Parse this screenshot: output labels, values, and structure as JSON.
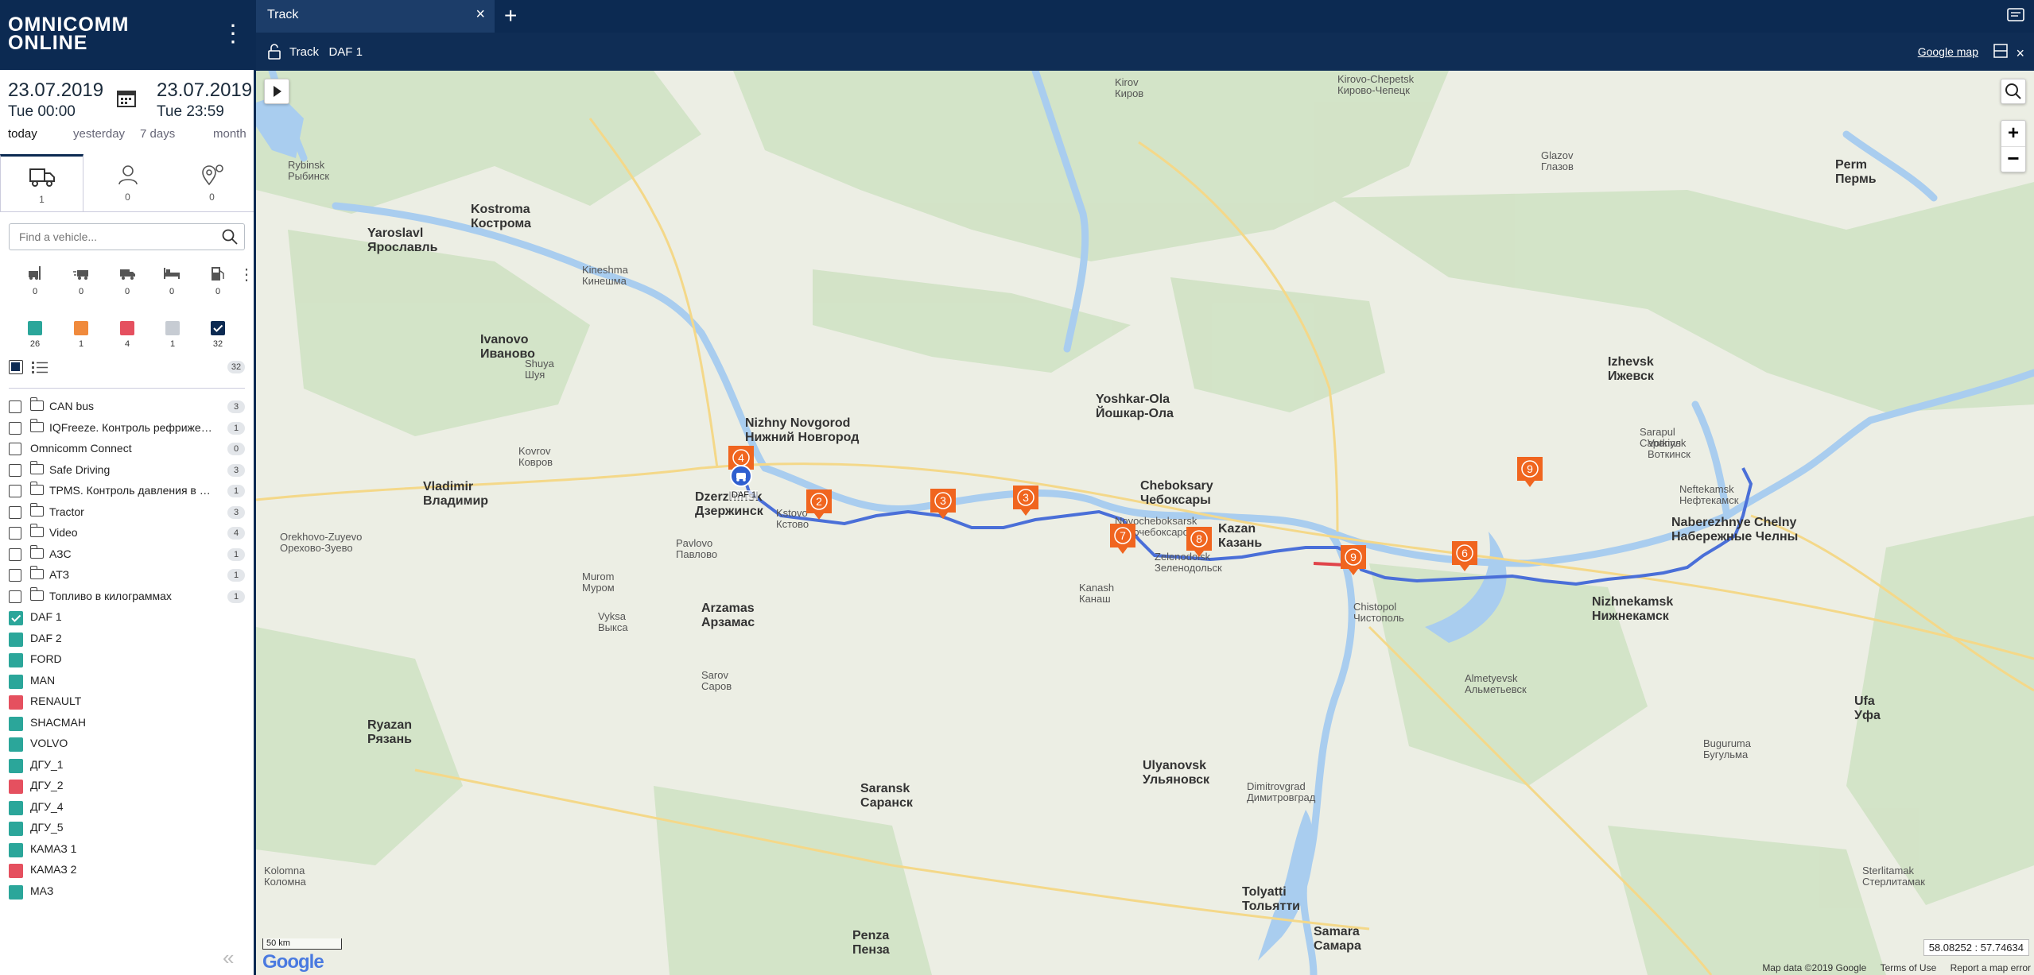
{
  "app": {
    "logo_line1": "OMNICOMM",
    "logo_line2": "ONLINE"
  },
  "dates": {
    "from_date": "23.07.2019",
    "from_time": "Tue 00:00",
    "to_date": "23.07.2019",
    "to_time": "Tue 23:59",
    "quick": [
      "today",
      "yesterday",
      "7 days",
      "month"
    ]
  },
  "tabs": [
    {
      "name": "vehicles",
      "count": "1"
    },
    {
      "name": "drivers",
      "count": "0"
    },
    {
      "name": "geozones",
      "count": "0"
    }
  ],
  "search": {
    "placeholder": "Find a vehicle..."
  },
  "status_counts": [
    "0",
    "0",
    "0",
    "0",
    "0"
  ],
  "color_filters": [
    {
      "color": "#2ba69a",
      "count": "26"
    },
    {
      "color": "#f08a3c",
      "count": "1"
    },
    {
      "color": "#e5505f",
      "count": "4"
    },
    {
      "color": "#c7ccd3",
      "count": "1"
    },
    {
      "color": "#0c2a52",
      "count": "32"
    }
  ],
  "total_count": "32",
  "groups": [
    {
      "label": "CAN bus",
      "count": "3"
    },
    {
      "label": "IQFreeze. Контроль рефрижератора",
      "count": "1"
    },
    {
      "label": "Omnicomm Connect",
      "count": "0"
    },
    {
      "label": "Safe Driving",
      "count": "3"
    },
    {
      "label": "TPMS. Контроль давления в шинах",
      "count": "1"
    },
    {
      "label": "Tractor",
      "count": "3"
    },
    {
      "label": "Video",
      "count": "4"
    },
    {
      "label": "АЗС",
      "count": "1"
    },
    {
      "label": "АТЗ",
      "count": "1"
    },
    {
      "label": "Топливо в килограммах",
      "count": "1"
    }
  ],
  "vehicles": [
    {
      "label": "DAF 1",
      "color": "#2ba69a",
      "checked": true
    },
    {
      "label": "DAF 2",
      "color": "#2ba69a"
    },
    {
      "label": "FORD",
      "color": "#2ba69a"
    },
    {
      "label": "MAN",
      "color": "#2ba69a"
    },
    {
      "label": "RENAULT",
      "color": "#e5505f"
    },
    {
      "label": "SHACMAH",
      "color": "#2ba69a"
    },
    {
      "label": "VOLVO",
      "color": "#2ba69a"
    },
    {
      "label": "ДГУ_1",
      "color": "#2ba69a"
    },
    {
      "label": "ДГУ_2",
      "color": "#e5505f"
    },
    {
      "label": "ДГУ_4",
      "color": "#2ba69a"
    },
    {
      "label": "ДГУ_5",
      "color": "#2ba69a"
    },
    {
      "label": "КАМАЗ 1",
      "color": "#2ba69a"
    },
    {
      "label": "КАМАЗ 2",
      "color": "#e5505f"
    },
    {
      "label": "МАЗ",
      "color": "#2ba69a"
    }
  ],
  "top_tab": {
    "label": "Track"
  },
  "sub_bar": {
    "title": "Track   DAF 1",
    "map_provider": "Google map"
  },
  "map": {
    "vehicle_label": "DAF 1",
    "coords": "58.08252 : 57.74634",
    "scale": "50 km",
    "google": "Google",
    "attrib": [
      "Map data ©2019 Google",
      "Terms of Use",
      "Report a map error"
    ],
    "markers": [
      "4",
      "2",
      "3",
      "3",
      "7",
      "8",
      "9",
      "6",
      "9"
    ],
    "cities": [
      {
        "name": "Kirov",
        "ru": "Киров"
      },
      {
        "name": "Kirovo-Chepetsk",
        "ru": "Кирово-Чепецк"
      },
      {
        "name": "Glazov",
        "ru": "Глазов"
      },
      {
        "name": "Perm",
        "ru": "Пермь"
      },
      {
        "name": "Rybinsk",
        "ru": "Рыбинск"
      },
      {
        "name": "Kostroma",
        "ru": "Кострома"
      },
      {
        "name": "Yaroslavl",
        "ru": "Ярославль"
      },
      {
        "name": "Kineshma",
        "ru": "Кинешма"
      },
      {
        "name": "Ivanovo",
        "ru": "Иваново"
      },
      {
        "name": "Shuya",
        "ru": "Шуя"
      },
      {
        "name": "Vladimir",
        "ru": "Владимир"
      },
      {
        "name": "Kovrov",
        "ru": "Ковров"
      },
      {
        "name": "Nizhny Novgorod",
        "ru": "Нижний Новгород"
      },
      {
        "name": "Dzerzhinsk",
        "ru": "Дзержинск"
      },
      {
        "name": "Kstovo",
        "ru": "Кстово"
      },
      {
        "name": "Cheboksary",
        "ru": "Чебоксары"
      },
      {
        "name": "Novocheboksarsk",
        "ru": "Новочебоксарск"
      },
      {
        "name": "Yoshkar-Ola",
        "ru": "Йошкар-Ола"
      },
      {
        "name": "Kazan",
        "ru": "Казань"
      },
      {
        "name": "Zelenodolsk",
        "ru": "Зеленодольск"
      },
      {
        "name": "Izhevsk",
        "ru": "Ижевск"
      },
      {
        "name": "Naberezhnye Chelny",
        "ru": "Набережные Челны"
      },
      {
        "name": "Nizhnekamsk",
        "ru": "Нижнекамск"
      },
      {
        "name": "Chistopol",
        "ru": "Чистополь"
      },
      {
        "name": "Almetyevsk",
        "ru": "Альметьевск"
      },
      {
        "name": "Ufa",
        "ru": "Уфа"
      },
      {
        "name": "Arzamas",
        "ru": "Арзамас"
      },
      {
        "name": "Murom",
        "ru": "Муром"
      },
      {
        "name": "Sarov",
        "ru": "Саров"
      },
      {
        "name": "Saransk",
        "ru": "Саранск"
      },
      {
        "name": "Ulyanovsk",
        "ru": "Ульяновск"
      },
      {
        "name": "Dimitrovgrad",
        "ru": "Димитровград"
      },
      {
        "name": "Tolyatti",
        "ru": "Тольятти"
      },
      {
        "name": "Samara",
        "ru": "Самара"
      },
      {
        "name": "Ryazan",
        "ru": "Рязань"
      },
      {
        "name": "Penza",
        "ru": "Пенза"
      },
      {
        "name": "Sterlitamak",
        "ru": "Стерлитамак"
      },
      {
        "name": "Buguruma",
        "ru": "Бугульма"
      },
      {
        "name": "Votkinsk",
        "ru": "Воткинск"
      },
      {
        "name": "Neftekamsk",
        "ru": "Нефтекамск"
      },
      {
        "name": "Sarapul",
        "ru": "Сарапул"
      },
      {
        "name": "Kanash",
        "ru": "Канаш"
      },
      {
        "name": "Orekhovo-Zuyevo",
        "ru": "Орехово-Зуево"
      },
      {
        "name": "Pavlovo",
        "ru": "Павлово"
      },
      {
        "name": "Vyksa",
        "ru": "Выкса"
      },
      {
        "name": "Kolomna",
        "ru": "Коломна"
      }
    ]
  }
}
